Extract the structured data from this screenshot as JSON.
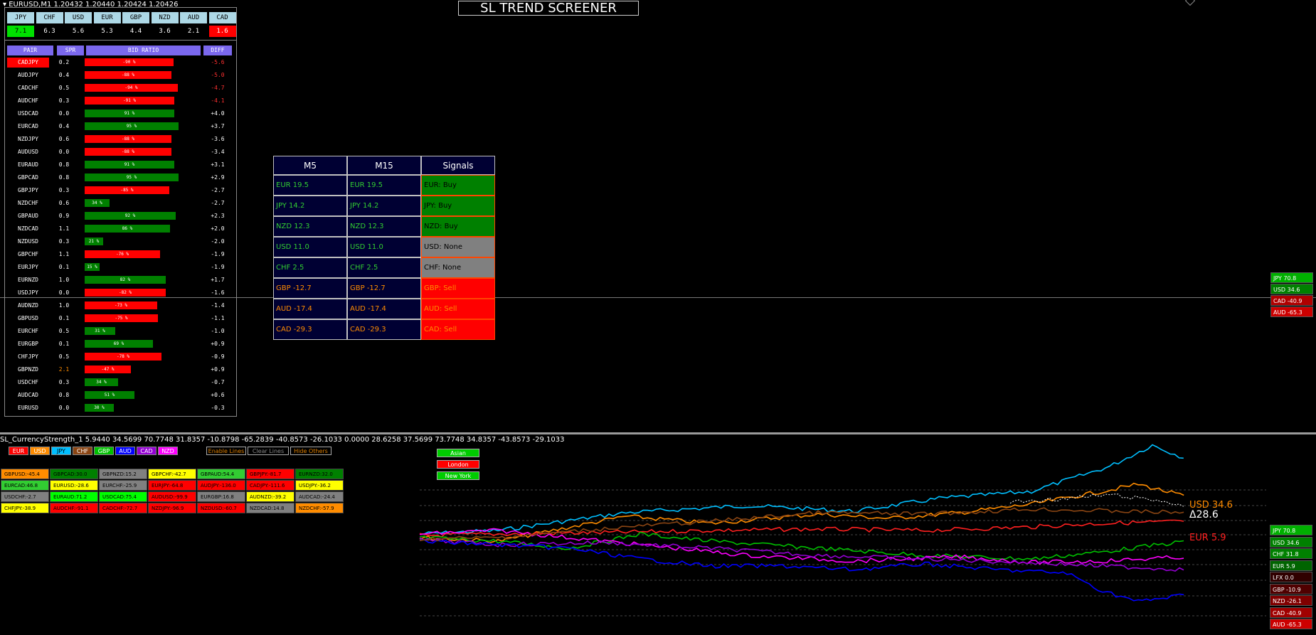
{
  "chart_header": "EURUSD,M1  1.20432 1.20440 1.20424 1.20426",
  "screener_title": "SL TREND SCREENER",
  "currency_strength": {
    "currencies": [
      {
        "name": "JPY",
        "value": "7.1",
        "bg": "#00e000",
        "fg": "#000"
      },
      {
        "name": "CHF",
        "value": "6.3",
        "bg": "",
        "fg": "#fff"
      },
      {
        "name": "USD",
        "value": "5.6",
        "bg": "",
        "fg": "#fff"
      },
      {
        "name": "EUR",
        "value": "5.3",
        "bg": "",
        "fg": "#fff"
      },
      {
        "name": "GBP",
        "value": "4.4",
        "bg": "",
        "fg": "#fff"
      },
      {
        "name": "NZD",
        "value": "3.6",
        "bg": "",
        "fg": "#fff"
      },
      {
        "name": "AUD",
        "value": "2.1",
        "bg": "",
        "fg": "#fff"
      },
      {
        "name": "CAD",
        "value": "1.6",
        "bg": "#ff0000",
        "fg": "#fff"
      }
    ],
    "headers": {
      "pair": "PAIR",
      "spr": "SPR",
      "ratio": "BID RATIO",
      "diff": "DIFF"
    },
    "rows": [
      {
        "pair": "CADJPY",
        "spr": "0.2",
        "ratio": "-90 %",
        "pct": 0.82,
        "color": "red",
        "diff": "-5.6",
        "diff_color": "#ff3030",
        "highlight": true
      },
      {
        "pair": "AUDJPY",
        "spr": "0.4",
        "ratio": "-88 %",
        "pct": 0.8,
        "color": "red",
        "diff": "-5.0",
        "diff_color": "#ff3030"
      },
      {
        "pair": "CADCHF",
        "spr": "0.5",
        "ratio": "-94 %",
        "pct": 0.86,
        "color": "red",
        "diff": "-4.7",
        "diff_color": "#ff3030"
      },
      {
        "pair": "AUDCHF",
        "spr": "0.3",
        "ratio": "-91 %",
        "pct": 0.83,
        "color": "red",
        "diff": "-4.1",
        "diff_color": "#ff3030"
      },
      {
        "pair": "USDCAD",
        "spr": "0.0",
        "ratio": "91 %",
        "pct": 0.83,
        "color": "green",
        "diff": "+4.0",
        "diff_color": "#fff"
      },
      {
        "pair": "EURCAD",
        "spr": "0.4",
        "ratio": "95 %",
        "pct": 0.87,
        "color": "green",
        "diff": "+3.7",
        "diff_color": "#fff"
      },
      {
        "pair": "NZDJPY",
        "spr": "0.6",
        "ratio": "-88 %",
        "pct": 0.8,
        "color": "red",
        "diff": "-3.6",
        "diff_color": "#fff"
      },
      {
        "pair": "AUDUSD",
        "spr": "0.0",
        "ratio": "-88 %",
        "pct": 0.8,
        "color": "red",
        "diff": "-3.4",
        "diff_color": "#fff"
      },
      {
        "pair": "EURAUD",
        "spr": "0.8",
        "ratio": "91 %",
        "pct": 0.83,
        "color": "green",
        "diff": "+3.1",
        "diff_color": "#fff"
      },
      {
        "pair": "GBPCAD",
        "spr": "0.8",
        "ratio": "95 %",
        "pct": 0.87,
        "color": "green",
        "diff": "+2.9",
        "diff_color": "#fff"
      },
      {
        "pair": "GBPJPY",
        "spr": "0.3",
        "ratio": "-85 %",
        "pct": 0.78,
        "color": "red",
        "diff": "-2.7",
        "diff_color": "#fff"
      },
      {
        "pair": "NZDCHF",
        "spr": "0.6",
        "ratio": "34 %",
        "pct": 0.23,
        "color": "green",
        "diff": "-2.7",
        "diff_color": "#fff"
      },
      {
        "pair": "GBPAUD",
        "spr": "0.9",
        "ratio": "92 %",
        "pct": 0.84,
        "color": "green",
        "diff": "+2.3",
        "diff_color": "#fff"
      },
      {
        "pair": "NZDCAD",
        "spr": "1.1",
        "ratio": "86 %",
        "pct": 0.79,
        "color": "green",
        "diff": "+2.0",
        "diff_color": "#fff"
      },
      {
        "pair": "NZDUSD",
        "spr": "0.3",
        "ratio": "21 %",
        "pct": 0.17,
        "color": "green",
        "diff": "-2.0",
        "diff_color": "#fff"
      },
      {
        "pair": "GBPCHF",
        "spr": "1.1",
        "ratio": "-76 %",
        "pct": 0.7,
        "color": "red",
        "diff": "-1.9",
        "diff_color": "#fff"
      },
      {
        "pair": "EURJPY",
        "spr": "0.1",
        "ratio": "15 %",
        "pct": 0.14,
        "color": "green",
        "diff": "-1.9",
        "diff_color": "#fff"
      },
      {
        "pair": "EURNZD",
        "spr": "1.0",
        "ratio": "82 %",
        "pct": 0.75,
        "color": "green",
        "diff": "+1.7",
        "diff_color": "#fff"
      },
      {
        "pair": "USDJPY",
        "spr": "0.0",
        "ratio": "-82 %",
        "pct": 0.75,
        "color": "red",
        "diff": "-1.6",
        "diff_color": "#fff"
      },
      {
        "pair": "AUDNZD",
        "spr": "1.0",
        "ratio": "-73 %",
        "pct": 0.67,
        "color": "red",
        "diff": "-1.4",
        "diff_color": "#fff"
      },
      {
        "pair": "GBPUSD",
        "spr": "0.1",
        "ratio": "-75 %",
        "pct": 0.68,
        "color": "red",
        "diff": "-1.1",
        "diff_color": "#fff"
      },
      {
        "pair": "EURCHF",
        "spr": "0.5",
        "ratio": "31 %",
        "pct": 0.28,
        "color": "green",
        "diff": "-1.0",
        "diff_color": "#fff"
      },
      {
        "pair": "EURGBP",
        "spr": "0.1",
        "ratio": "69 %",
        "pct": 0.63,
        "color": "green",
        "diff": "+0.9",
        "diff_color": "#fff"
      },
      {
        "pair": "CHFJPY",
        "spr": "0.5",
        "ratio": "-78 %",
        "pct": 0.71,
        "color": "red",
        "diff": "-0.9",
        "diff_color": "#fff"
      },
      {
        "pair": "GBPNZD",
        "spr": "2.1",
        "ratio": "-47 %",
        "pct": 0.43,
        "color": "red",
        "diff": "+0.9",
        "diff_color": "#fff",
        "spr_color": "#ff8c00"
      },
      {
        "pair": "USDCHF",
        "spr": "0.3",
        "ratio": "34 %",
        "pct": 0.31,
        "color": "green",
        "diff": "-0.7",
        "diff_color": "#fff"
      },
      {
        "pair": "AUDCAD",
        "spr": "0.8",
        "ratio": "51 %",
        "pct": 0.46,
        "color": "green",
        "diff": "+0.6",
        "diff_color": "#fff"
      },
      {
        "pair": "EURUSD",
        "spr": "0.0",
        "ratio": "30 %",
        "pct": 0.27,
        "color": "green",
        "diff": "-0.3",
        "diff_color": "#fff"
      }
    ]
  },
  "signals": {
    "headers": [
      "M5",
      "M15",
      "Signals"
    ],
    "rows": [
      {
        "m5": "EUR  19.5",
        "m15": "EUR  19.5",
        "signal": "EUR: Buy",
        "tone": "buy"
      },
      {
        "m5": "JPY  14.2",
        "m15": "JPY  14.2",
        "signal": "JPY: Buy",
        "tone": "buy"
      },
      {
        "m5": "NZD  12.3",
        "m15": "NZD  12.3",
        "signal": "NZD: Buy",
        "tone": "buy"
      },
      {
        "m5": "USD  11.0",
        "m15": "USD  11.0",
        "signal": "USD: None",
        "tone": "none"
      },
      {
        "m5": "CHF  2.5",
        "m15": "CHF  2.5",
        "signal": "CHF: None",
        "tone": "none"
      },
      {
        "m5": "GBP  -12.7",
        "m15": "GBP  -12.7",
        "signal": "GBP: Sell",
        "tone": "sell"
      },
      {
        "m5": "AUD  -17.4",
        "m15": "AUD  -17.4",
        "signal": "AUD: Sell",
        "tone": "sell"
      },
      {
        "m5": "CAD  -29.3",
        "m15": "CAD  -29.3",
        "signal": "CAD: Sell",
        "tone": "sell"
      }
    ]
  },
  "right_tags_top": [
    {
      "label": "JPY 70.8",
      "bg": "#00b000"
    },
    {
      "label": "USD 34.6",
      "bg": "#008000"
    },
    {
      "label": "CAD -40.9",
      "bg": "#b00000"
    },
    {
      "label": "AUD -65.3",
      "bg": "#cc0000"
    }
  ],
  "indicator": {
    "title": "SL_CurrencyStrength_1 5.9440 34.5699 70.7748 31.8357 -10.8798 -65.2839 -40.8573 -26.1033 0.0000 28.6258 37.5699 73.7748 34.8357 -43.8573 -29.1033",
    "currency_buttons": [
      {
        "label": "EUR",
        "bg": "#ff0000",
        "fg": "#fff"
      },
      {
        "label": "USD",
        "bg": "#ff8c00",
        "fg": "#fff"
      },
      {
        "label": "JPY",
        "bg": "#00bfff",
        "fg": "#000"
      },
      {
        "label": "CHF",
        "bg": "#8b4513",
        "fg": "#fff"
      },
      {
        "label": "GBP",
        "bg": "#00c000",
        "fg": "#fff"
      },
      {
        "label": "AUD",
        "bg": "#0000ff",
        "fg": "#fff"
      },
      {
        "label": "CAD",
        "bg": "#9400d3",
        "fg": "#fff"
      },
      {
        "label": "NZD",
        "bg": "#ff00ff",
        "fg": "#fff"
      }
    ],
    "controls": [
      "Enable Lines",
      "Clear Lines",
      "Hide Others"
    ],
    "sessions": [
      {
        "label": "Asian",
        "bg": "#00cc00"
      },
      {
        "label": "London",
        "bg": "#ff0000"
      },
      {
        "label": "New York",
        "bg": "#00cc00"
      }
    ],
    "pair_grid": [
      [
        {
          "t": "GBPUSD:-45.4",
          "bg": "#ff8c00"
        },
        {
          "t": "GBPCAD:30.0",
          "bg": "#008000"
        },
        {
          "t": "GBPNZD:15.2",
          "bg": "#808080"
        },
        {
          "t": "GBPCHF:-42.7",
          "bg": "#ffff00",
          "fg": "#000"
        },
        {
          "t": "GBPAUD:54.4",
          "bg": "#32cd32"
        },
        {
          "t": "GBPJPY:-81.7",
          "bg": "#ff0000"
        },
        {
          "t": "EURNZD:32.0",
          "bg": "#008000"
        }
      ],
      [
        {
          "t": "EURCAD:46.8",
          "bg": "#32cd32",
          "fg": "#000"
        },
        {
          "t": "EURUSD:-28.6",
          "bg": "#ffff00",
          "fg": "#000"
        },
        {
          "t": "EURCHF:-25.9",
          "bg": "#808080"
        },
        {
          "t": "EURJPY:-64.8",
          "bg": "#ff0000"
        },
        {
          "t": "AUDJPY:-136.0",
          "bg": "#ff0000"
        },
        {
          "t": "CADJPY:-111.6",
          "bg": "#ff0000"
        },
        {
          "t": "USDJPY:-36.2",
          "bg": "#ffff00",
          "fg": "#000"
        }
      ],
      [
        {
          "t": "USDCHF:-2.7",
          "bg": "#808080"
        },
        {
          "t": "EURAUD:71.2",
          "bg": "#00ff00",
          "fg": "#000"
        },
        {
          "t": "USDCAD:75.4",
          "bg": "#00ff00",
          "fg": "#000"
        },
        {
          "t": "AUDUSD:-99.9",
          "bg": "#ff0000"
        },
        {
          "t": "EURGBP:16.8",
          "bg": "#808080"
        },
        {
          "t": "AUDNZD:-39.2",
          "bg": "#ffff00",
          "fg": "#000"
        },
        {
          "t": "AUDCAD:-24.4",
          "bg": "#808080"
        }
      ],
      [
        {
          "t": "CHFJPY:-38.9",
          "bg": "#ffff00",
          "fg": "#000"
        },
        {
          "t": "AUDCHF:-91.1",
          "bg": "#ff0000"
        },
        {
          "t": "CADCHF:-72.7",
          "bg": "#ff0000"
        },
        {
          "t": "NZDJPY:-96.9",
          "bg": "#ff0000"
        },
        {
          "t": "NZDUSD:-60.7",
          "bg": "#ff0000"
        },
        {
          "t": "NZDCAD:14.8",
          "bg": "#808080"
        },
        {
          "t": "NZDCHF:-57.9",
          "bg": "#ff8c00"
        }
      ]
    ],
    "line_labels": [
      {
        "text": "USD  34.6",
        "color": "#ff8c00"
      },
      {
        "text": "Δ28.6",
        "color": "#ffffff"
      },
      {
        "text": "EUR  5.9",
        "color": "#ff2020"
      }
    ],
    "right_tags": [
      {
        "label": "JPY 70.8",
        "bg": "#00b000"
      },
      {
        "label": "USD 34.6",
        "bg": "#008000"
      },
      {
        "label": "CHF 31.8",
        "bg": "#008000"
      },
      {
        "label": "EUR 5.9",
        "bg": "#006400"
      },
      {
        "label": "LFX 0.0",
        "bg": "#300000"
      },
      {
        "label": "GBP -10.9",
        "bg": "#500000"
      },
      {
        "label": "NZD -26.1",
        "bg": "#800000"
      },
      {
        "label": "CAD -40.9",
        "bg": "#a00000"
      },
      {
        "label": "AUD -65.3",
        "bg": "#cc0000"
      }
    ]
  }
}
